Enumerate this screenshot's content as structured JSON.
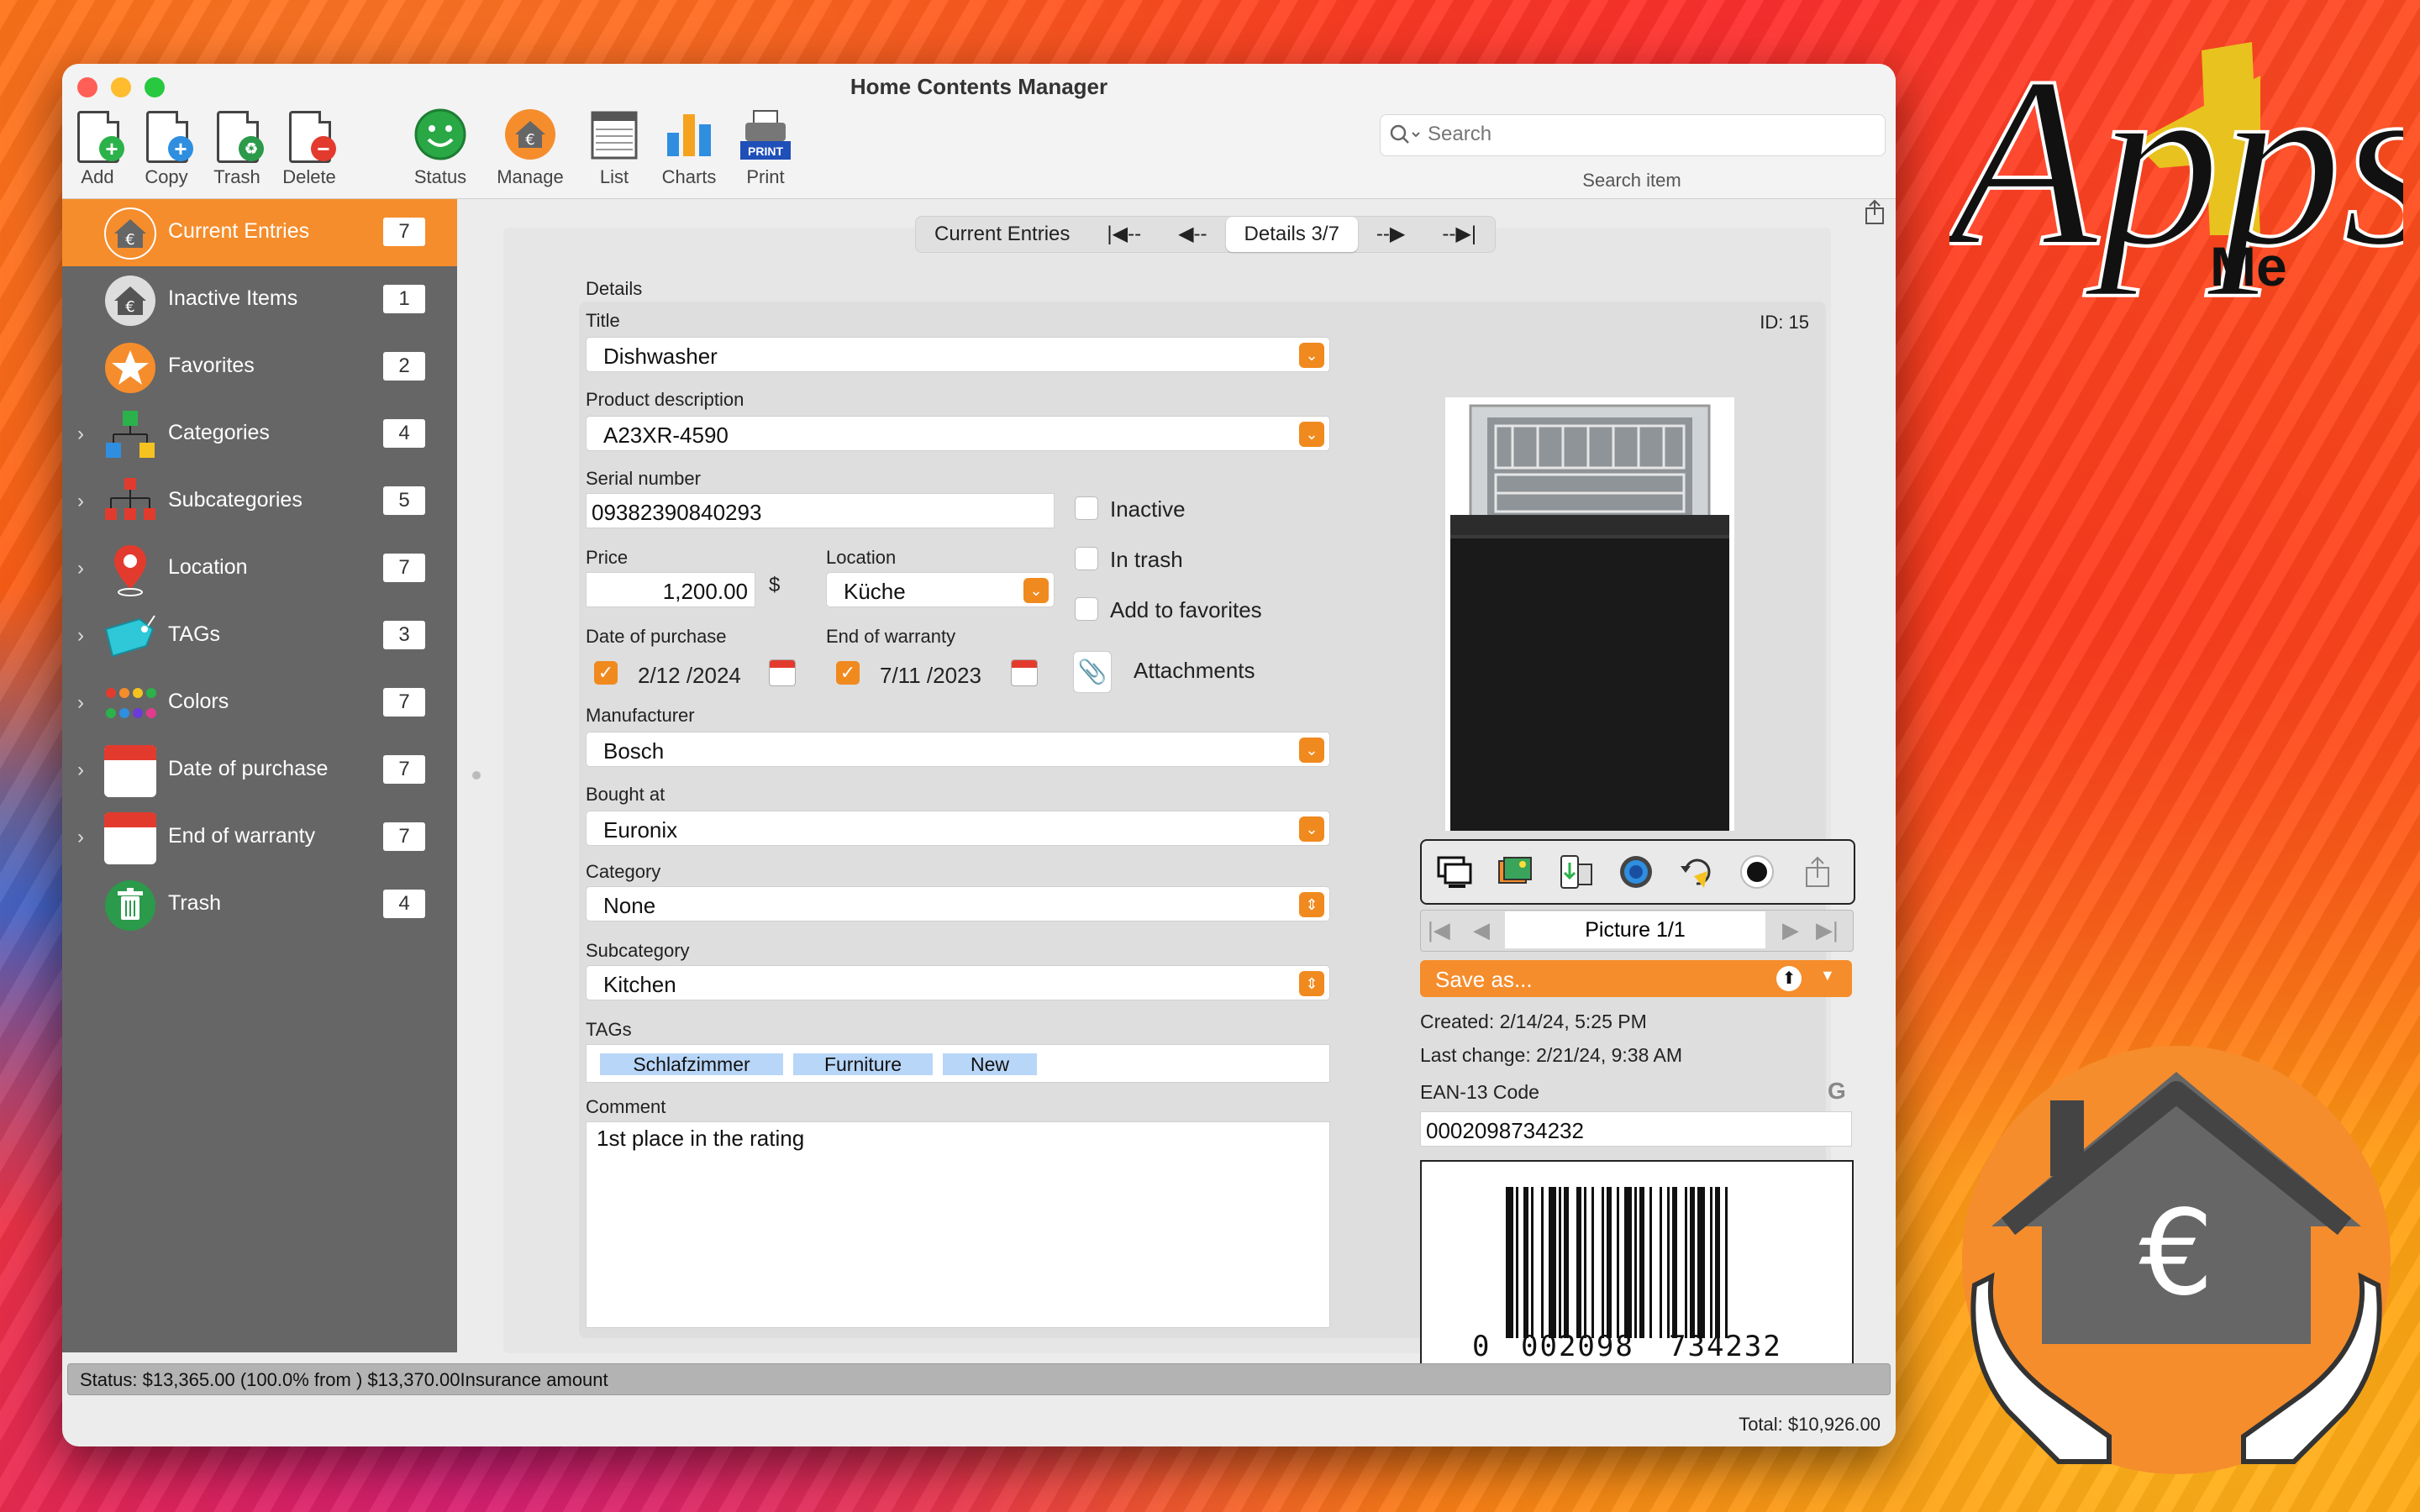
{
  "window": {
    "title": "Home Contents Manager"
  },
  "toolbar": {
    "add": "Add",
    "copy": "Copy",
    "trash": "Trash",
    "delete": "Delete",
    "status": "Status",
    "manage": "Manage",
    "list": "List",
    "charts": "Charts",
    "print": "Print",
    "print_badge": "PRINT"
  },
  "search": {
    "placeholder": "Search",
    "caption": "Search item"
  },
  "sidebar": {
    "items": [
      {
        "label": "Current Entries",
        "count": "7"
      },
      {
        "label": "Inactive Items",
        "count": "1"
      },
      {
        "label": "Favorites",
        "count": "2"
      },
      {
        "label": "Categories",
        "count": "4"
      },
      {
        "label": "Subcategories",
        "count": "5"
      },
      {
        "label": "Location",
        "count": "7"
      },
      {
        "label": "TAGs",
        "count": "3"
      },
      {
        "label": "Colors",
        "count": "7"
      },
      {
        "label": "Date of purchase",
        "count": "7"
      },
      {
        "label": "End of warranty",
        "count": "7"
      },
      {
        "label": "Trash",
        "count": "4"
      }
    ]
  },
  "nav": {
    "current_entries": "Current Entries",
    "first": "|◀--",
    "prev": "◀--",
    "details": "Details 3/7",
    "next": "--▶",
    "last": "--▶|"
  },
  "details": {
    "section": "Details",
    "id": "ID: 15",
    "title_label": "Title",
    "title": "Dishwasher",
    "desc_label": "Product description",
    "desc": "A23XR-4590",
    "serial_label": "Serial number",
    "serial": "09382390840293",
    "price_label": "Price",
    "price": "1,200.00",
    "currency": "$",
    "location_label": "Location",
    "location": "Küche",
    "purchase_label": "Date of purchase",
    "purchase": "2/12 /2024",
    "warranty_label": "End of warranty",
    "warranty": "7/11 /2023",
    "inactive": "Inactive",
    "in_trash": "In trash",
    "favorites": "Add to favorites",
    "attachments": "Attachments",
    "manufacturer_label": "Manufacturer",
    "manufacturer": "Bosch",
    "bought_label": "Bought at",
    "bought": "Euronix",
    "category_label": "Category",
    "category": "None",
    "subcategory_label": "Subcategory",
    "subcategory": "Kitchen",
    "tags_label": "TAGs",
    "tags": [
      "Schlafzimmer",
      "Furniture",
      "New"
    ],
    "comment_label": "Comment",
    "comment": "1st place in the rating"
  },
  "picture": {
    "counter": "Picture 1/1",
    "save_as": "Save as...",
    "created": "Created: 2/14/24, 5:25 PM",
    "last_change": "Last change: 2/21/24, 9:38 AM",
    "ean_label": "EAN-13 Code",
    "ean": "0002098734232",
    "barcode_text": [
      "0",
      "002098",
      "734232"
    ]
  },
  "statusbar": {
    "status": "Status: $13,365.00 (100.0% from ) $13,370.00Insurance amount",
    "total": "Total: $10,926.00"
  },
  "brand": {
    "apps": "Apps",
    "four": "4",
    "me": "Me"
  },
  "colors": {
    "accent": "#f58d2c",
    "sidebar": "#666666",
    "tag": "#b8d6f8"
  }
}
